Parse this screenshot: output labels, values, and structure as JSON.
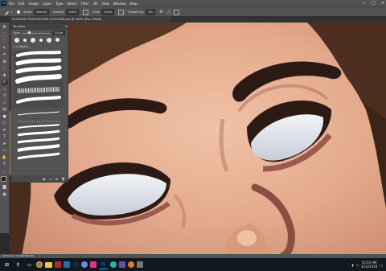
{
  "app": {
    "logo": "Ps"
  },
  "menu": {
    "items": [
      "File",
      "Edit",
      "Image",
      "Layer",
      "Type",
      "Select",
      "Filter",
      "3D",
      "View",
      "Window",
      "Help"
    ]
  },
  "window_controls": {
    "minimize": "—",
    "maximize": "□",
    "close": "✕"
  },
  "options": {
    "mode_label": "Mode:",
    "mode_value": "Normal",
    "opacity_label": "Opacity:",
    "opacity_value": "100%",
    "flow_label": "Flow:",
    "flow_value": "100%",
    "smoothing_label": "Smoothing:",
    "smoothing_value": "0%"
  },
  "document": {
    "tab_title": "LOCATION FROM KITCHEN CUTSCENE.psd @ 300% (Eks, RGB/8)"
  },
  "brushes_panel": {
    "title": "Brushes",
    "size_label": "Size:",
    "size_value": "21 px",
    "group_label": "Kyle's..."
  },
  "statusbar": {
    "text": "300%    Doc: 30.9M/188.1M"
  },
  "taskbar": {
    "time": "10:54 AM",
    "date": "3/10/2019"
  },
  "colors": {
    "skin": "#e3a98c",
    "skin_light": "#ebb89c",
    "hair": "#5a3624",
    "brow": "#2e1a14",
    "eye_white": "#dbe0e8",
    "crease": "#9a5a50",
    "ps_chrome": "#535353"
  }
}
